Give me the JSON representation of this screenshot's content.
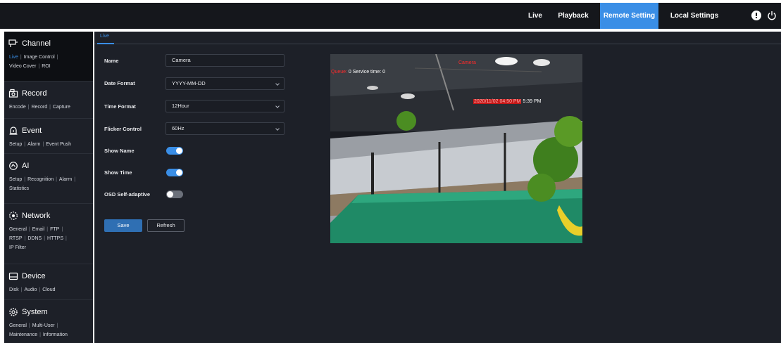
{
  "topnav": {
    "items": [
      {
        "label": "Live",
        "active": false
      },
      {
        "label": "Playback",
        "active": false
      },
      {
        "label": "Remote Setting",
        "active": true
      },
      {
        "label": "Local Settings",
        "active": false
      }
    ],
    "icons": [
      "alert-icon",
      "power-icon"
    ]
  },
  "sidebar": {
    "groups": [
      {
        "title": "Channel",
        "icon": "channel-icon",
        "links": [
          "Live",
          "Image Control",
          "Video Cover",
          "ROI"
        ],
        "active_link": "Live"
      },
      {
        "title": "Record",
        "icon": "record-icon",
        "links": [
          "Encode",
          "Record",
          "Capture"
        ]
      },
      {
        "title": "Event",
        "icon": "event-icon",
        "links": [
          "Setup",
          "Alarm",
          "Event Push"
        ]
      },
      {
        "title": "AI",
        "icon": "ai-icon",
        "links": [
          "Setup",
          "Recognition",
          "Alarm",
          "Statistics"
        ]
      },
      {
        "title": "Network",
        "icon": "network-icon",
        "links": [
          "General",
          "Email",
          "FTP",
          "RTSP",
          "DDNS",
          "HTTPS",
          "IP Filter"
        ]
      },
      {
        "title": "Device",
        "icon": "device-icon",
        "links": [
          "Disk",
          "Audio",
          "Cloud"
        ]
      },
      {
        "title": "System",
        "icon": "gear-icon",
        "links": [
          "General",
          "Multi-User",
          "Maintenance",
          "Information"
        ]
      }
    ]
  },
  "main": {
    "tab": "Live",
    "form": {
      "name_label": "Name",
      "name_value": "Camera",
      "date_format_label": "Date Format",
      "date_format_value": "YYYY-MM-DD",
      "time_format_label": "Time Format",
      "time_format_value": "12Hour",
      "flicker_label": "Flicker Control",
      "flicker_value": "60Hz",
      "show_name_label": "Show Name",
      "show_name": true,
      "show_time_label": "Show Time",
      "show_time": true,
      "osd_label": "OSD Self-adaptive",
      "osd": false
    },
    "buttons": {
      "save": "Save",
      "refresh": "Refresh"
    },
    "preview": {
      "osd_name": "Camera",
      "osd_queue_prefix": "Queue:",
      "osd_queue_text": "0 Service time:  0",
      "osd_time_red": "2020/11/02 04:50 PM",
      "osd_time_white": "5:39 PM"
    }
  },
  "colors": {
    "accent": "#3a8ee6",
    "background": "#1d2028",
    "topbar": "#15171c"
  }
}
